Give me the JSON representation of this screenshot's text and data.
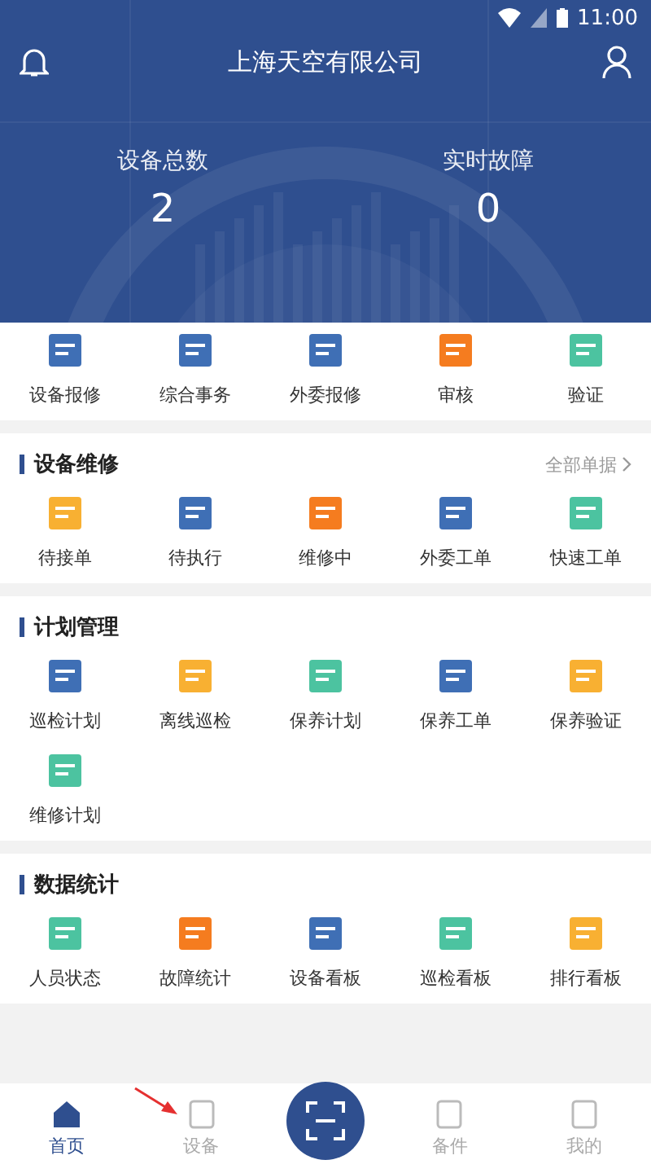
{
  "status_bar": {
    "time": "11:00"
  },
  "header": {
    "title": "上海天空有限公司",
    "stats": [
      {
        "label": "设备总数",
        "value": "2"
      },
      {
        "label": "实时故障",
        "value": "0"
      }
    ]
  },
  "quick_actions": [
    {
      "label": "设备报修",
      "color": "#3f6fb5"
    },
    {
      "label": "综合事务",
      "color": "#3f6fb5"
    },
    {
      "label": "外委报修",
      "color": "#3f6fb5"
    },
    {
      "label": "审核",
      "color": "#f57c1f"
    },
    {
      "label": "验证",
      "color": "#4cc3a0"
    }
  ],
  "sections": [
    {
      "title": "设备维修",
      "link": "全部单据",
      "items": [
        {
          "label": "待接单",
          "color": "#f8b032"
        },
        {
          "label": "待执行",
          "color": "#3f6fb5"
        },
        {
          "label": "维修中",
          "color": "#f57c1f"
        },
        {
          "label": "外委工单",
          "color": "#3f6fb5"
        },
        {
          "label": "快速工单",
          "color": "#4cc3a0"
        }
      ]
    },
    {
      "title": "计划管理",
      "items": [
        {
          "label": "巡检计划",
          "color": "#3f6fb5"
        },
        {
          "label": "离线巡检",
          "color": "#f8b032"
        },
        {
          "label": "保养计划",
          "color": "#4cc3a0"
        },
        {
          "label": "保养工单",
          "color": "#3f6fb5"
        },
        {
          "label": "保养验证",
          "color": "#f8b032"
        },
        {
          "label": "维修计划",
          "color": "#4cc3a0"
        }
      ]
    },
    {
      "title": "数据统计",
      "items": [
        {
          "label": "人员状态",
          "color": "#4cc3a0"
        },
        {
          "label": "故障统计",
          "color": "#f57c1f"
        },
        {
          "label": "设备看板",
          "color": "#3f6fb5"
        },
        {
          "label": "巡检看板",
          "color": "#4cc3a0"
        },
        {
          "label": "排行看板",
          "color": "#f8b032"
        }
      ]
    }
  ],
  "bottom_nav": [
    {
      "label": "首页",
      "selected": true
    },
    {
      "label": "设备",
      "selected": false
    },
    {
      "kind": "scan"
    },
    {
      "label": "备件",
      "selected": false
    },
    {
      "label": "我的",
      "selected": false
    }
  ]
}
